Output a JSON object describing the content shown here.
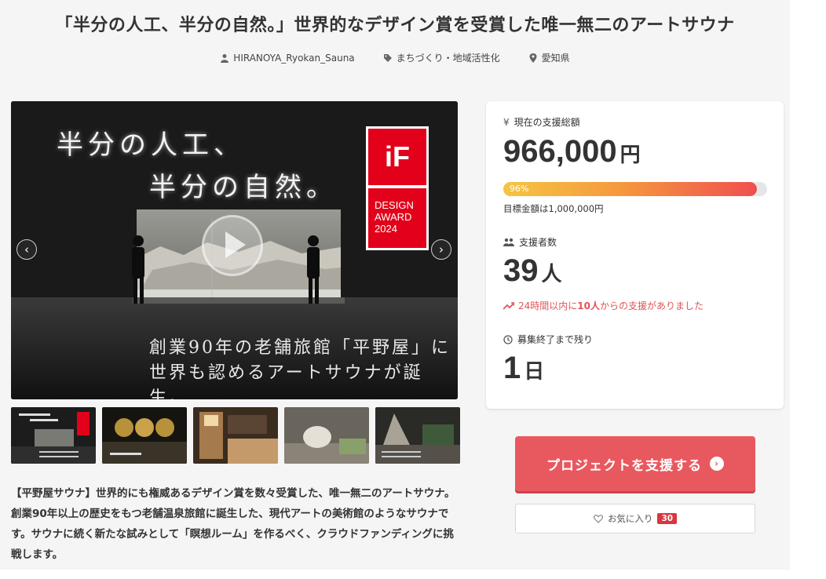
{
  "title": "「半分の人工、半分の自然。」世界的なデザイン賞を受賞した唯一無二のアートサウナ",
  "meta": {
    "author": "HIRANOYA_Ryokan_Sauna",
    "category": "まちづくり・地域活性化",
    "location": "愛知県"
  },
  "hero": {
    "line1": "半分の人工、",
    "line2": "半分の自然。",
    "caption1": "創業90年の老舗旅館「平野屋」に",
    "caption2": "世界も認めるアートサウナが誕生。",
    "badge_logo": "iF",
    "badge_lines": [
      "DESIGN",
      "AWARD",
      "2024"
    ],
    "prev": "‹",
    "next": "›"
  },
  "description": "【平野屋サウナ】世界的にも権威あるデザイン賞を数々受賞した、唯一無二のアートサウナ。創業90年以上の歴史をもつ老舗温泉旅館に誕生した、現代アートの美術館のようなサウナです。サウナに続く新たな試みとして「瞑想ルーム」を作るべく、クラウドファンディングに挑戦します。",
  "stats": {
    "total_label": "現在の支援総額",
    "total_amount": "966,000",
    "yen_unit": "円",
    "progress_text": "96%",
    "progress_value": 96,
    "goal_text": "目標金額は1,000,000円",
    "supporters_label": "支援者数",
    "supporters_count": "39",
    "supporters_unit": "人",
    "trend_prefix": "24時間以内に",
    "trend_count": "10人",
    "trend_suffix": "からの支援がありました",
    "remaining_label": "募集終了まで残り",
    "remaining_count": "1",
    "remaining_unit": "日"
  },
  "buttons": {
    "support": "プロジェクトを支援する",
    "favorite": "お気に入り",
    "favorite_count": "30"
  },
  "colors": {
    "accent": "#e8595f",
    "badge_red": "#e2001a",
    "trend": "#e05555"
  }
}
